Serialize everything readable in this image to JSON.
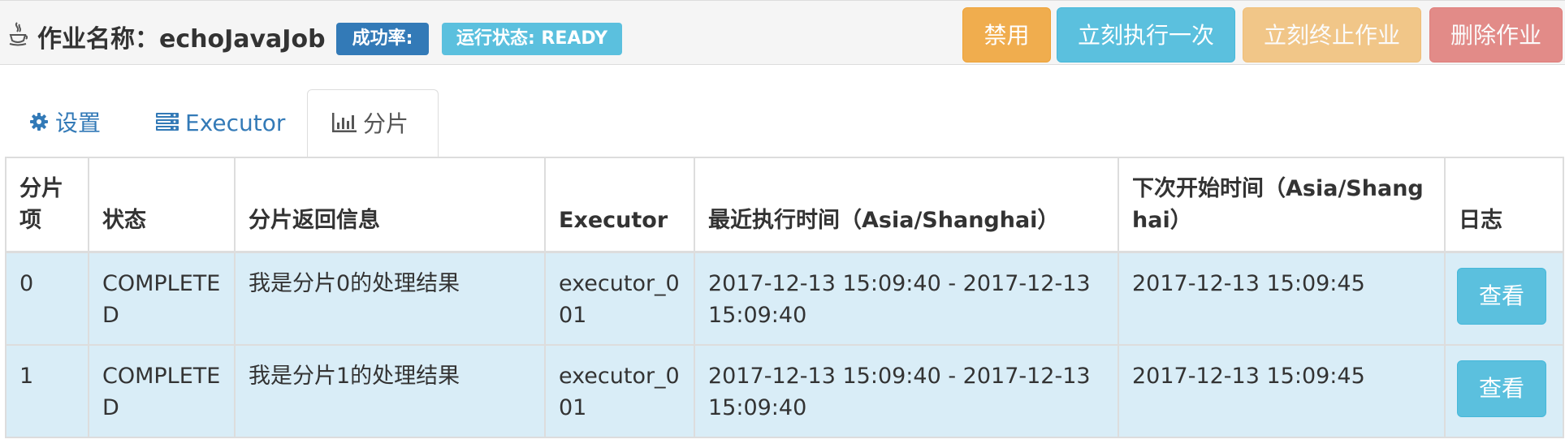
{
  "header": {
    "title_prefix": "作业名称：",
    "job_name": "echoJavaJob",
    "success_badge": "成功率:",
    "status_badge": "运行状态: READY",
    "buttons": {
      "disable": "禁用",
      "run_once": "立刻执行一次",
      "stop": "立刻终止作业",
      "delete": "删除作业"
    },
    "icon": "java-icon"
  },
  "tabs": [
    {
      "label": "设置",
      "icon": "gear-icon"
    },
    {
      "label": "Executor",
      "icon": "server-icon"
    },
    {
      "label": "分片",
      "icon": "bar-chart-icon",
      "active": true
    }
  ],
  "table": {
    "headers": [
      "分片项",
      "状态",
      "分片返回信息",
      "Executor",
      "最近执行时间（Asia/Shanghai）",
      "下次开始时间（Asia/Shanghai）",
      "日志"
    ],
    "rows": [
      {
        "item": "0",
        "status": "COMPLETED",
        "message": "我是分片0的处理结果",
        "executor": "executor_001",
        "last_time": "2017-12-13 15:09:40 - 2017-12-13 15:09:40",
        "next_time": "2017-12-13 15:09:45",
        "log_button": "查看"
      },
      {
        "item": "1",
        "status": "COMPLETED",
        "message": "我是分片1的处理结果",
        "executor": "executor_001",
        "last_time": "2017-12-13 15:09:40 - 2017-12-13 15:09:40",
        "next_time": "2017-12-13 15:09:45",
        "log_button": "查看"
      }
    ]
  },
  "colors": {
    "primary": "#337ab7",
    "info": "#5bc0de",
    "warning": "#f0ad4e",
    "danger": "#d9534f",
    "row_highlight": "#d9edf7"
  }
}
